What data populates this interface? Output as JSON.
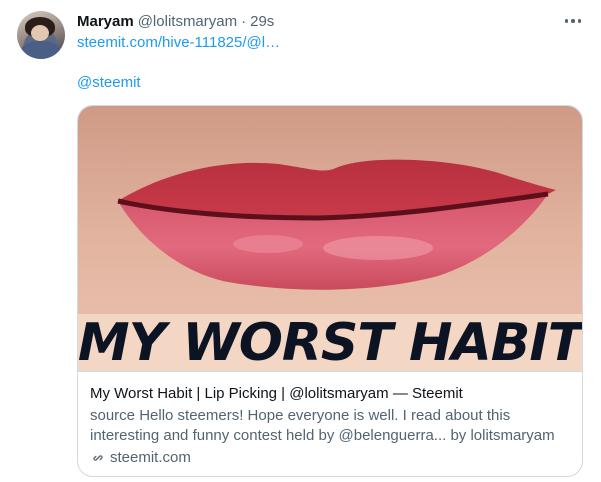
{
  "tweet": {
    "author_name": "Maryam",
    "author_handle": "@lolitsmaryam",
    "separator": "·",
    "timestamp": "29s",
    "link_text": "steemit.com/hive-111825/@l…",
    "mention": "@steemit"
  },
  "card": {
    "image_text": "MY WORST HABIT",
    "title": "My Worst Habit | Lip Picking | @lolitsmaryam — Steemit",
    "description": "source Hello steemers! Hope everyone is well. I read about this interesting and funny contest held by @belenguerra... by lolitsmaryam",
    "domain": "steemit.com"
  },
  "colors": {
    "link": "#1d9bf0",
    "secondary_text": "#536471",
    "primary_text": "#0f1419",
    "border": "#cfd9de"
  },
  "icons": {
    "more": "more-horizontal-icon",
    "link": "link-icon"
  }
}
